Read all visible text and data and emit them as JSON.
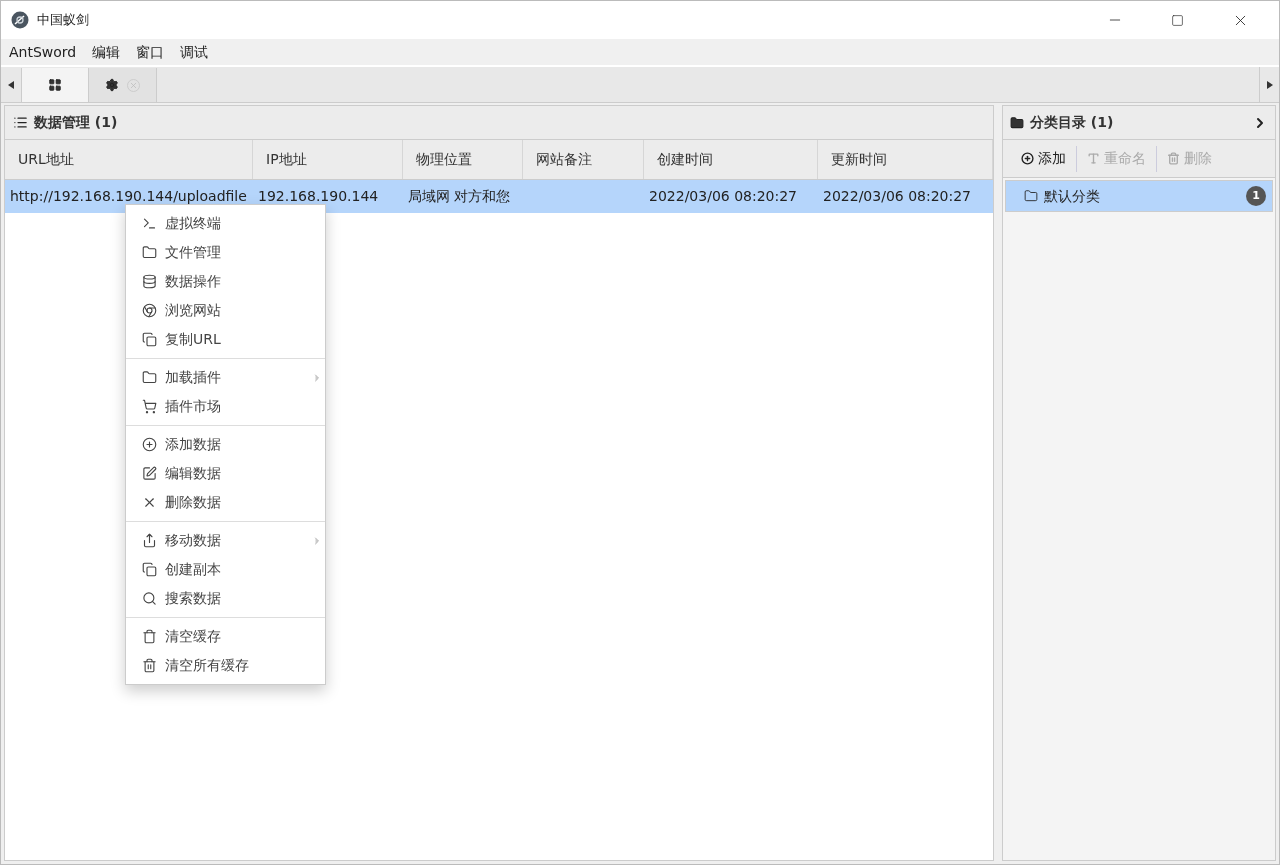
{
  "window": {
    "title": "中国蚁剑"
  },
  "menu_bar": [
    "AntSword",
    "编辑",
    "窗口",
    "调试"
  ],
  "tabs": [
    {
      "selected": true,
      "closable": false
    },
    {
      "selected": false,
      "closable": true
    }
  ],
  "data_panel": {
    "title": "数据管理 (1)",
    "columns": [
      "URL地址",
      "IP地址",
      "物理位置",
      "网站备注",
      "创建时间",
      "更新时间"
    ],
    "rows": [
      {
        "selected": true,
        "cells": [
          "http://192.168.190.144/uploadfile",
          "192.168.190.144",
          "局域网 对方和您",
          "",
          "2022/03/06 08:20:27",
          "2022/03/06 08:20:27"
        ]
      }
    ]
  },
  "context_menu": [
    {
      "items": [
        {
          "label": "虚拟终端",
          "has_submenu": false
        },
        {
          "label": "文件管理",
          "has_submenu": false
        },
        {
          "label": "数据操作",
          "has_submenu": false
        },
        {
          "label": "浏览网站",
          "has_submenu": false
        },
        {
          "label": "复制URL",
          "has_submenu": false
        }
      ]
    },
    {
      "items": [
        {
          "label": "加载插件",
          "has_submenu": true
        },
        {
          "label": "插件市场",
          "has_submenu": false
        }
      ]
    },
    {
      "items": [
        {
          "label": "添加数据",
          "has_submenu": false
        },
        {
          "label": "编辑数据",
          "has_submenu": false
        },
        {
          "label": "删除数据",
          "has_submenu": false
        }
      ]
    },
    {
      "items": [
        {
          "label": "移动数据",
          "has_submenu": true
        },
        {
          "label": "创建副本",
          "has_submenu": false
        },
        {
          "label": "搜索数据",
          "has_submenu": false
        }
      ]
    },
    {
      "items": [
        {
          "label": "清空缓存",
          "has_submenu": false
        },
        {
          "label": "清空所有缓存",
          "has_submenu": false
        }
      ]
    }
  ],
  "category_panel": {
    "title": "分类目录 (1)",
    "toolbar": [
      {
        "label": "添加",
        "disabled": false
      },
      {
        "label": "重命名",
        "disabled": true
      },
      {
        "label": "删除",
        "disabled": true
      }
    ],
    "items": [
      {
        "label": "默认分类",
        "count": "1",
        "selected": true
      }
    ]
  }
}
